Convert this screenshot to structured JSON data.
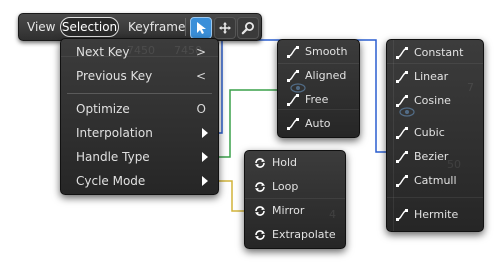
{
  "menubar": {
    "view": "View",
    "selection": "Selection",
    "keyframe": "Keyframe"
  },
  "selection_menu": {
    "items": [
      {
        "label": "Next Key",
        "shortcut": ">"
      },
      {
        "label": "Previous Key",
        "shortcut": "<"
      },
      {
        "label": "Optimize",
        "shortcut": "O"
      },
      {
        "label": "Interpolation"
      },
      {
        "label": "Handle Type"
      },
      {
        "label": "Cycle Mode"
      }
    ],
    "background_text": [
      "7450",
      "7450"
    ]
  },
  "handle_type_menu": {
    "items": [
      "Smooth",
      "Aligned",
      "Free",
      "Auto"
    ]
  },
  "cycle_mode_menu": {
    "items": [
      "Hold",
      "Loop",
      "Mirror",
      "Extrapolate"
    ],
    "background_text": "4"
  },
  "interpolation_menu": {
    "items": [
      "Constant",
      "Linear",
      "Cosine",
      "Cubic",
      "Bezier",
      "Catmull",
      "Hermite"
    ],
    "background_text": [
      "7",
      "50"
    ]
  },
  "colors": {
    "accent": "#3a8fd9",
    "connector_interpolation": "#2b5fd0",
    "connector_handle": "#3aa04a",
    "connector_cycle": "#d2b43a",
    "menu_bg": "#2e2e2e"
  },
  "icons": {
    "select_tool": "arrow-cursor-icon",
    "move_tool": "move-cross-icon",
    "search_tool": "magnifier-icon",
    "curve": "curve-icon",
    "cycle": "cycle-arrows-icon",
    "submenu": "triangle-right-icon",
    "visibility": "eye-icon"
  }
}
